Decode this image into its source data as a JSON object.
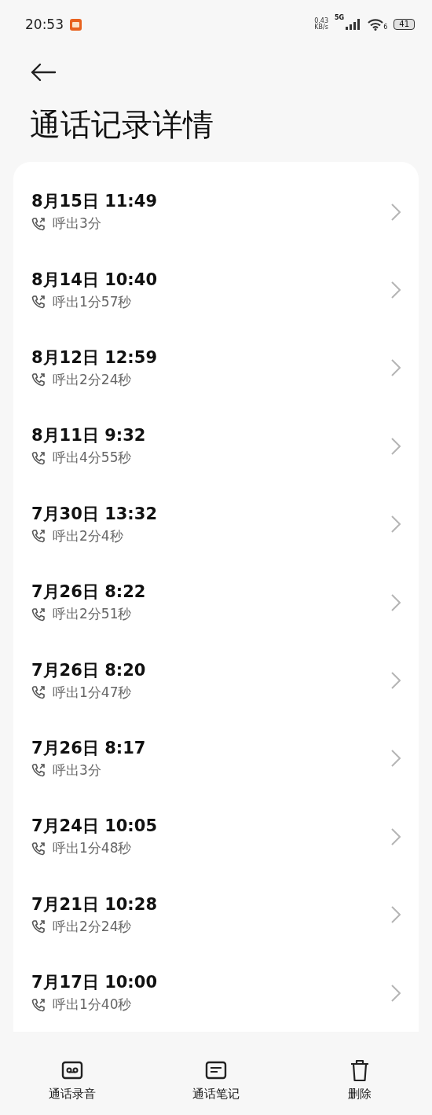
{
  "status_bar": {
    "time": "20:53",
    "net_speed": "0.43",
    "net_unit": "KB/s",
    "network": "5G",
    "wifi_label": "6",
    "battery": "41"
  },
  "title": "通话记录详情",
  "calls": [
    {
      "datetime": "8月15日 11:49",
      "detail": "呼出3分"
    },
    {
      "datetime": "8月14日 10:40",
      "detail": "呼出1分57秒"
    },
    {
      "datetime": "8月12日 12:59",
      "detail": "呼出2分24秒"
    },
    {
      "datetime": "8月11日 9:32",
      "detail": "呼出4分55秒"
    },
    {
      "datetime": "7月30日 13:32",
      "detail": "呼出2分4秒"
    },
    {
      "datetime": "7月26日 8:22",
      "detail": "呼出2分51秒"
    },
    {
      "datetime": "7月26日 8:20",
      "detail": "呼出1分47秒"
    },
    {
      "datetime": "7月26日 8:17",
      "detail": "呼出3分"
    },
    {
      "datetime": "7月24日 10:05",
      "detail": "呼出1分48秒"
    },
    {
      "datetime": "7月21日 10:28",
      "detail": "呼出2分24秒"
    },
    {
      "datetime": "7月17日 10:00",
      "detail": "呼出1分40秒"
    }
  ],
  "actions": [
    {
      "kind": "recording",
      "label": "通话录音"
    },
    {
      "kind": "notes",
      "label": "通话笔记"
    },
    {
      "kind": "delete",
      "label": "删除"
    }
  ]
}
